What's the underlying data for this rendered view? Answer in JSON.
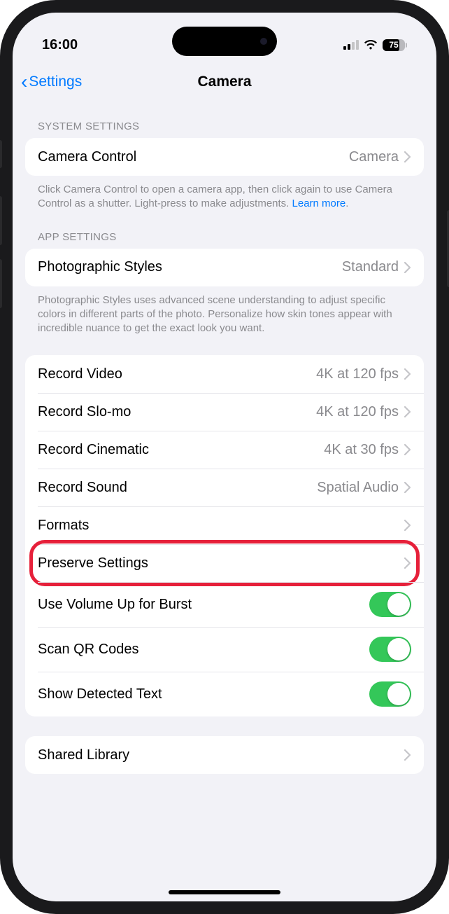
{
  "status": {
    "time": "16:00",
    "battery": "75"
  },
  "nav": {
    "back": "Settings",
    "title": "Camera"
  },
  "sections": {
    "system": {
      "header": "SYSTEM SETTINGS",
      "camera_control": {
        "label": "Camera Control",
        "value": "Camera"
      },
      "footer": "Click Camera Control to open a camera app, then click again to use Camera Control as a shutter. Light-press to make adjustments. ",
      "learn_more": "Learn more"
    },
    "app": {
      "header": "APP SETTINGS",
      "photographic_styles": {
        "label": "Photographic Styles",
        "value": "Standard"
      },
      "footer": "Photographic Styles uses advanced scene understanding to adjust specific colors in different parts of the photo. Personalize how skin tones appear with incredible nuance to get the exact look you want."
    },
    "record": {
      "items": [
        {
          "label": "Record Video",
          "value": "4K at 120 fps",
          "type": "nav"
        },
        {
          "label": "Record Slo-mo",
          "value": "4K at 120 fps",
          "type": "nav"
        },
        {
          "label": "Record Cinematic",
          "value": "4K at 30 fps",
          "type": "nav"
        },
        {
          "label": "Record Sound",
          "value": "Spatial Audio",
          "type": "nav"
        },
        {
          "label": "Formats",
          "value": "",
          "type": "nav"
        },
        {
          "label": "Preserve Settings",
          "value": "",
          "type": "nav",
          "highlight": true
        },
        {
          "label": "Use Volume Up for Burst",
          "type": "toggle",
          "on": true
        },
        {
          "label": "Scan QR Codes",
          "type": "toggle",
          "on": true
        },
        {
          "label": "Show Detected Text",
          "type": "toggle",
          "on": true
        }
      ]
    },
    "shared": {
      "label": "Shared Library"
    }
  }
}
